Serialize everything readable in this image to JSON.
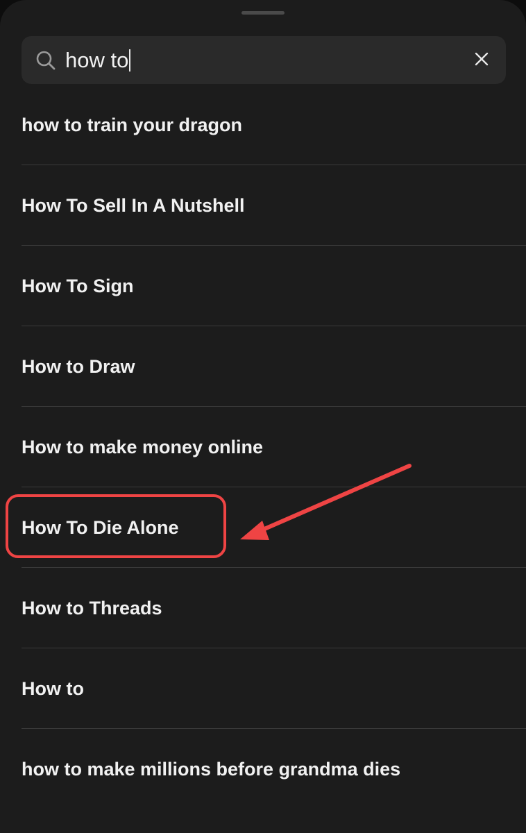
{
  "search": {
    "query": "how to",
    "icon": "search-icon",
    "clear_icon": "close-icon"
  },
  "results": [
    {
      "label": "how to train your dragon"
    },
    {
      "label": "How To Sell In A Nutshell"
    },
    {
      "label": "How To Sign"
    },
    {
      "label": "How to Draw"
    },
    {
      "label": "How to make money online"
    },
    {
      "label": "How To Die Alone"
    },
    {
      "label": "How to Threads"
    },
    {
      "label": "How to"
    },
    {
      "label": "how to make millions before grandma dies"
    }
  ],
  "annotation": {
    "highlighted_result": "How To Die Alone",
    "color": "#ef4444"
  },
  "colors": {
    "background": "#1c1c1c",
    "search_field": "#2a2a2a",
    "text": "#f1f1f1",
    "divider": "#3a3a3a"
  }
}
